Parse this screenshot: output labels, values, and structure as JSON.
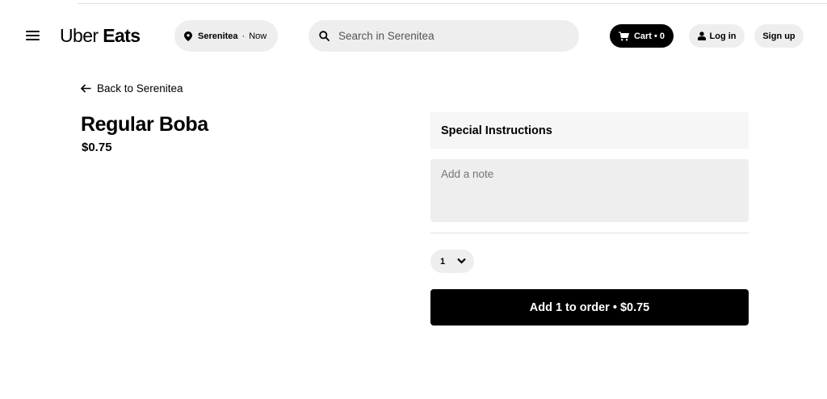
{
  "header": {
    "logo_part1": "Uber",
    "logo_part2": "Eats",
    "location": "Serenitea",
    "location_sep": "·",
    "time": "Now",
    "search_placeholder": "Search in Serenitea",
    "cart_label": "Cart • 0",
    "login_label": "Log in",
    "signup_label": "Sign up",
    "icons": {
      "menu": "hamburger-menu-icon",
      "location": "location-pin-icon",
      "search": "search-icon",
      "cart": "cart-icon",
      "user": "user-icon"
    }
  },
  "back_link": {
    "label": "Back to Serenitea",
    "icon": "arrow-left-icon"
  },
  "item": {
    "title": "Regular Boba",
    "price": "$0.75"
  },
  "instructions": {
    "header": "Special Instructions",
    "note_placeholder": "Add a note",
    "note_value": ""
  },
  "quantity": {
    "selected": "1",
    "icon": "chevron-down-icon"
  },
  "add_button": {
    "label": "Add 1 to order • $0.75"
  },
  "colors": {
    "primary": "#000000",
    "pill_bg": "#eeeeee",
    "panel_bg": "#f6f6f6",
    "background": "#ffffff"
  }
}
